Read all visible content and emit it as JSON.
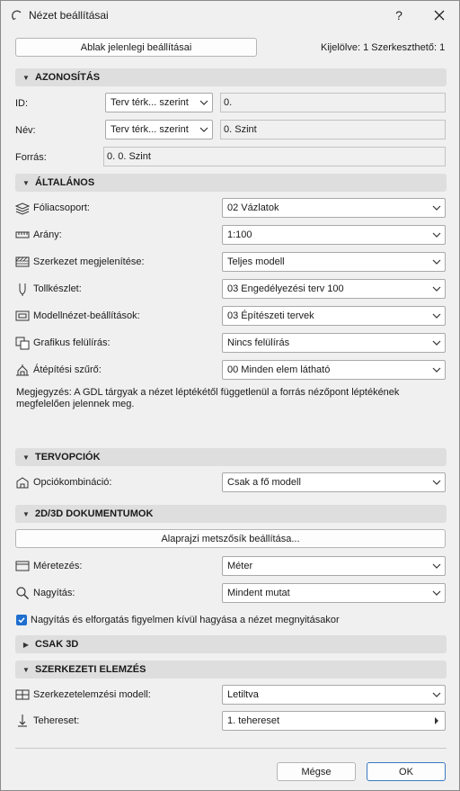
{
  "window": {
    "title": "Nézet beállításai",
    "help_label": "?",
    "close_label": "✕"
  },
  "top": {
    "current_settings_button": "Ablak jelenlegi beállításai",
    "selection_info": "Kijelölve: 1 Szerkeszthető: 1"
  },
  "sections": {
    "identification": "AZONOSÍTÁS",
    "general": "ÁLTALÁNOS",
    "design_options": "TERVOPCIÓK",
    "documents_2d3d": "2D/3D DOKUMENTUMOK",
    "only_3d": "CSAK 3D",
    "structural_analysis": "SZERKEZETI ELEMZÉS"
  },
  "identification": {
    "id_label": "ID:",
    "id_mode": "Terv térk... szerint",
    "id_value": "0.",
    "name_label": "Név:",
    "name_mode": "Terv térk... szerint",
    "name_value": "0. Szint",
    "source_label": "Forrás:",
    "source_value": "0. 0. Szint"
  },
  "general": {
    "layer_combo_label": "Fóliacsoport:",
    "layer_combo_value": "02 Vázlatok",
    "scale_label": "Arány:",
    "scale_value": "1:100",
    "structure_display_label": "Szerkezet megjelenítése:",
    "structure_display_value": "Teljes modell",
    "pen_set_label": "Tollkészlet:",
    "pen_set_value": "03 Engedélyezési terv 100",
    "model_view_label": "Modellnézet-beállítások:",
    "model_view_value": "03 Építészeti tervek",
    "graphic_override_label": "Grafikus felülírás:",
    "graphic_override_value": "Nincs felülírás",
    "renovation_filter_label": "Átépítési szűrő:",
    "renovation_filter_value": "00 Minden elem látható",
    "note": "Megjegyzés: A GDL tárgyak a nézet léptékétől függetlenül a forrás nézőpont léptékének megfelelően jelennek meg."
  },
  "design_options": {
    "combination_label": "Opciókombináció:",
    "combination_value": "Csak a fő modell"
  },
  "documents": {
    "floor_plan_cut_button": "Alaprajzi metszősík beállítása...",
    "dimensioning_label": "Méretezés:",
    "dimensioning_value": "Méter",
    "zoom_label": "Nagyítás:",
    "zoom_value": "Mindent mutat",
    "ignore_zoom_label": "Nagyítás és elforgatás figyelmen kívül hagyása a nézet megnyitásakor"
  },
  "structural": {
    "analytical_model_label": "Szerkezetelemzési modell:",
    "analytical_model_value": "Letiltva",
    "load_case_label": "Tehereset:",
    "load_case_value": "1. tehereset"
  },
  "footer": {
    "cancel_label": "Mégse",
    "ok_label": "OK"
  },
  "colors": {
    "accent": "#1f6fd0",
    "section_bg": "#dedede",
    "window_bg": "#f0f0f0"
  }
}
